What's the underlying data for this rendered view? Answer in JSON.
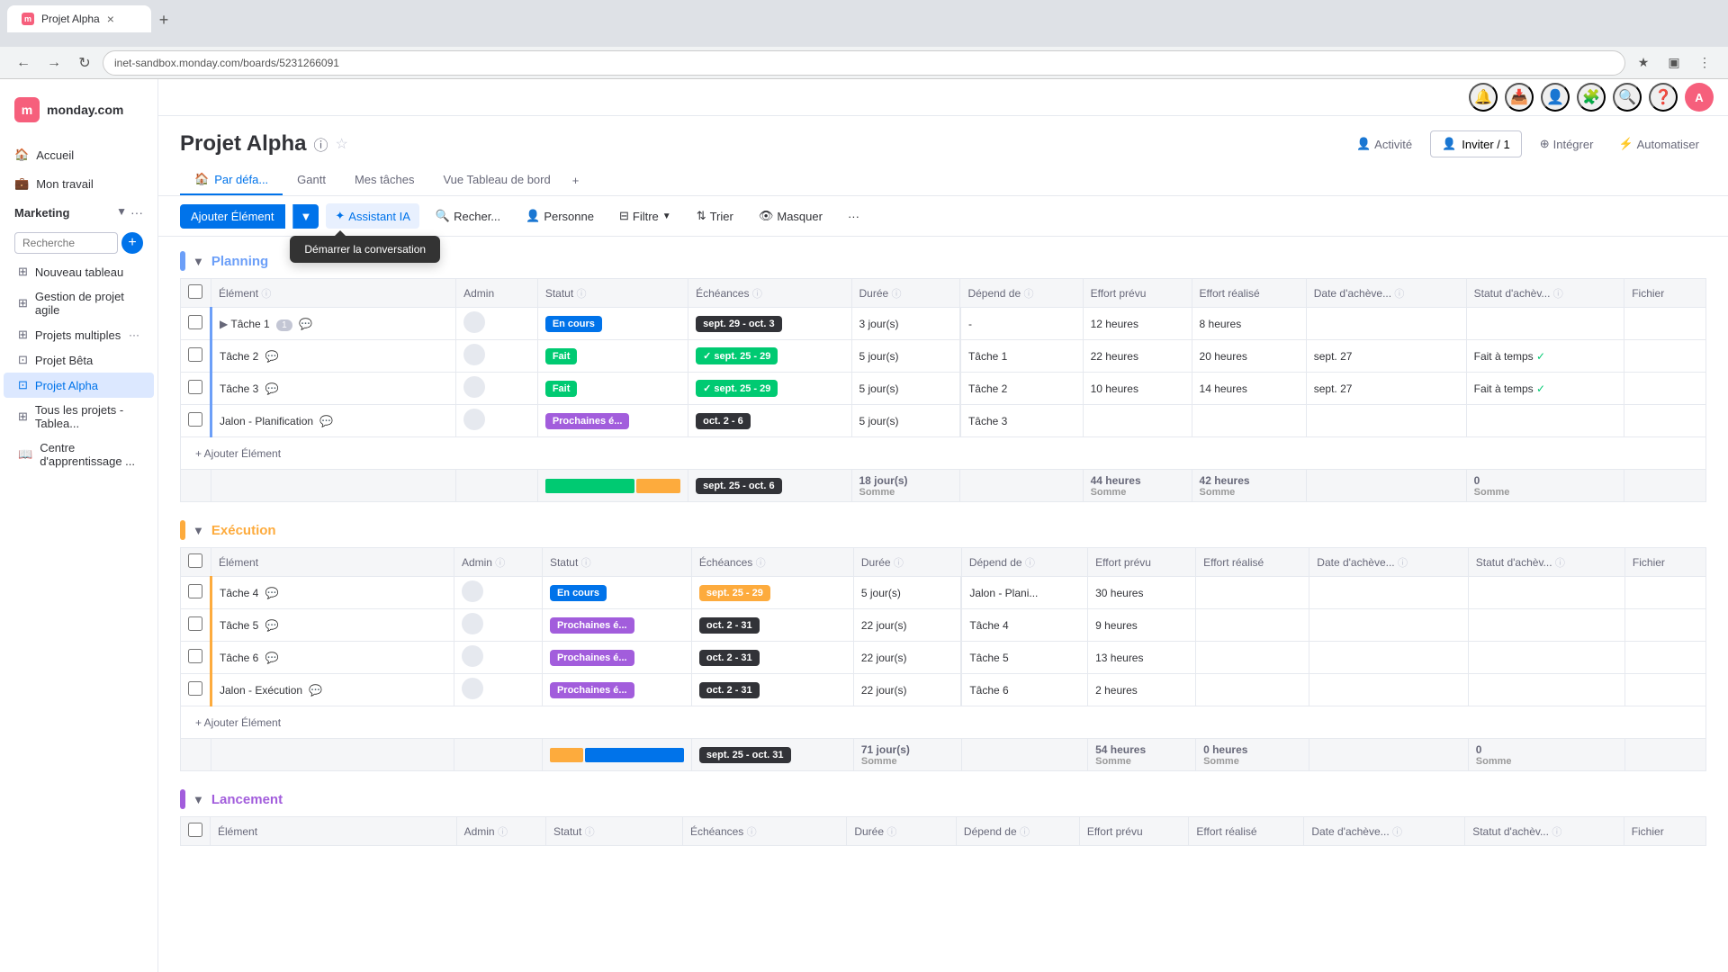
{
  "browser": {
    "tab_title": "Projet Alpha",
    "url": "inet-sandbox.monday.com/boards/5231266091",
    "tab_close": "×",
    "tab_new": "+"
  },
  "sidebar": {
    "logo_text": "monday.com",
    "logo_initial": "m",
    "nav_items": [
      {
        "label": "Accueil",
        "id": "accueil"
      },
      {
        "label": "Mon travail",
        "id": "mon-travail"
      }
    ],
    "section_label": "Marketing",
    "search_placeholder": "Recherche",
    "items": [
      {
        "label": "Nouveau tableau",
        "id": "nouveau-tableau",
        "active": false
      },
      {
        "label": "Gestion de projet agile",
        "id": "gestion-projet",
        "active": false
      },
      {
        "label": "Projets multiples",
        "id": "projets-multiples",
        "active": false
      },
      {
        "label": "Projet Bêta",
        "id": "projet-beta",
        "active": false
      },
      {
        "label": "Projet Alpha",
        "id": "projet-alpha",
        "active": true
      },
      {
        "label": "Tous les projets - Tablea...",
        "id": "tous-projets",
        "active": false
      },
      {
        "label": "Centre d'apprentissage ...",
        "id": "centre-apprentissage",
        "active": false
      }
    ]
  },
  "header": {
    "title": "Projet Alpha",
    "activity_label": "Activité",
    "invite_label": "Inviter / 1",
    "tabs": [
      {
        "label": "Par défa...",
        "active": true
      },
      {
        "label": "Gantt",
        "active": false
      },
      {
        "label": "Mes tâches",
        "active": false
      },
      {
        "label": "Vue Tableau de bord",
        "active": false
      }
    ],
    "tab_add": "+"
  },
  "toolbar": {
    "add_label": "Ajouter Élément",
    "assistant_label": "Assistant IA",
    "search_label": "Recher...",
    "person_label": "Personne",
    "filter_label": "Filtre",
    "sort_label": "Trier",
    "hide_label": "Masquer",
    "more_label": "···",
    "tooltip_label": "Démarrer la conversation",
    "integrer_label": "Intégrer",
    "automatiser_label": "Automatiser"
  },
  "groups": [
    {
      "id": "planning",
      "title": "Planning",
      "color_class": "group-color-planning",
      "title_class": "group-title-planning",
      "columns": [
        "Élément",
        "Admin",
        "Statut",
        "Échéances",
        "Durée",
        "Dépend de",
        "Effort prévu",
        "Effort réalisé",
        "Date d'achève...",
        "Statut d'achèv...",
        "Fichier"
      ],
      "rows": [
        {
          "element": "Tâche 1",
          "badge": "1",
          "admin": "",
          "statut": "En cours",
          "statut_class": "badge-blue",
          "echeance": "sept. 29 - oct. 3",
          "echeance_class": "badge-date-dark",
          "duree": "3 jour(s)",
          "depend": "-",
          "effort_prevu": "12 heures",
          "effort_realise": "8 heures",
          "date_acheve": "",
          "statut_acheve": "",
          "fichier": "",
          "has_tooltip": true
        },
        {
          "element": "Tâche 2",
          "admin": "",
          "statut": "Fait",
          "statut_class": "badge-green",
          "echeance": "✓sept. 25 - 29",
          "echeance_class": "badge-date-green",
          "duree": "5 jour(s)",
          "depend": "Tâche 1",
          "effort_prevu": "22 heures",
          "effort_realise": "20 heures",
          "date_acheve": "sept. 27",
          "statut_acheve": "Fait à temps",
          "fichier": ""
        },
        {
          "element": "Tâche 3",
          "admin": "",
          "statut": "Fait",
          "statut_class": "badge-green",
          "echeance": "✓sept. 25 - 29",
          "echeance_class": "badge-date-green",
          "duree": "5 jour(s)",
          "depend": "Tâche 2",
          "effort_prevu": "10 heures",
          "effort_realise": "14 heures",
          "date_acheve": "sept. 27",
          "statut_acheve": "Fait à temps",
          "fichier": ""
        },
        {
          "element": "Jalon - Planification",
          "admin": "",
          "statut": "Prochaines é...",
          "statut_class": "badge-purple",
          "echeance": "oct. 2 - 6",
          "echeance_class": "badge-date-dark",
          "duree": "5 jour(s)",
          "depend": "Tâche 3",
          "effort_prevu": "",
          "effort_realise": "",
          "date_acheve": "",
          "statut_acheve": "",
          "fichier": ""
        }
      ],
      "sum": {
        "echeance": "sept. 25 - oct. 6",
        "duree": "18 jour(s)",
        "duree_label": "Somme",
        "effort_prevu": "44 heures",
        "effort_prevu_label": "Somme",
        "effort_realise": "42 heures",
        "effort_realise_label": "Somme",
        "statut_acheve": "0",
        "statut_acheve_label": "Somme"
      }
    },
    {
      "id": "execution",
      "title": "Exécution",
      "color_class": "group-color-execution",
      "title_class": "group-title-execution",
      "columns": [
        "Élément",
        "Admin",
        "Statut",
        "Échéances",
        "Durée",
        "Dépend de",
        "Effort prévu",
        "Effort réalisé",
        "Date d'achève...",
        "Statut d'achèv...",
        "Fichier"
      ],
      "rows": [
        {
          "element": "Tâche 4",
          "admin": "",
          "statut": "En cours",
          "statut_class": "badge-blue",
          "echeance": "sept. 25 - 29",
          "echeance_class": "badge-date-orange",
          "duree": "5 jour(s)",
          "depend": "Jalon - Plani...",
          "effort_prevu": "30 heures",
          "effort_realise": "",
          "date_acheve": "",
          "statut_acheve": "",
          "fichier": ""
        },
        {
          "element": "Tâche 5",
          "admin": "",
          "statut": "Prochaines é...",
          "statut_class": "badge-purple",
          "echeance": "oct. 2 - 31",
          "echeance_class": "badge-date-dark",
          "duree": "22 jour(s)",
          "depend": "Tâche 4",
          "effort_prevu": "9 heures",
          "effort_realise": "",
          "date_acheve": "",
          "statut_acheve": "",
          "fichier": ""
        },
        {
          "element": "Tâche 6",
          "admin": "",
          "statut": "Prochaines é...",
          "statut_class": "badge-purple",
          "echeance": "oct. 2 - 31",
          "echeance_class": "badge-date-dark",
          "duree": "22 jour(s)",
          "depend": "Tâche 5",
          "effort_prevu": "13 heures",
          "effort_realise": "",
          "date_acheve": "",
          "statut_acheve": "",
          "fichier": ""
        },
        {
          "element": "Jalon - Exécution",
          "admin": "",
          "statut": "Prochaines é...",
          "statut_class": "badge-purple",
          "echeance": "oct. 2 - 31",
          "echeance_class": "badge-date-dark",
          "duree": "22 jour(s)",
          "depend": "Tâche 6",
          "effort_prevu": "2 heures",
          "effort_realise": "",
          "date_acheve": "",
          "statut_acheve": "",
          "fichier": ""
        }
      ],
      "sum": {
        "echeance": "sept. 25 - oct. 31",
        "duree": "71 jour(s)",
        "duree_label": "Somme",
        "effort_prevu": "54 heures",
        "effort_prevu_label": "Somme",
        "effort_realise": "0 heures",
        "effort_realise_label": "Somme",
        "statut_acheve": "0",
        "statut_acheve_label": "Somme"
      }
    },
    {
      "id": "lancement",
      "title": "Lancement",
      "color_class": "group-color-lancement",
      "title_class": "group-title-lancement",
      "columns": [
        "Élément",
        "Admin",
        "Statut",
        "Échéances",
        "Durée",
        "Dépend de",
        "Effort prévu",
        "Effort réalisé",
        "Date d'achève...",
        "Statut d'achèv...",
        "Fichier"
      ],
      "rows": []
    }
  ],
  "add_element_label": "+ Ajouter Élément"
}
